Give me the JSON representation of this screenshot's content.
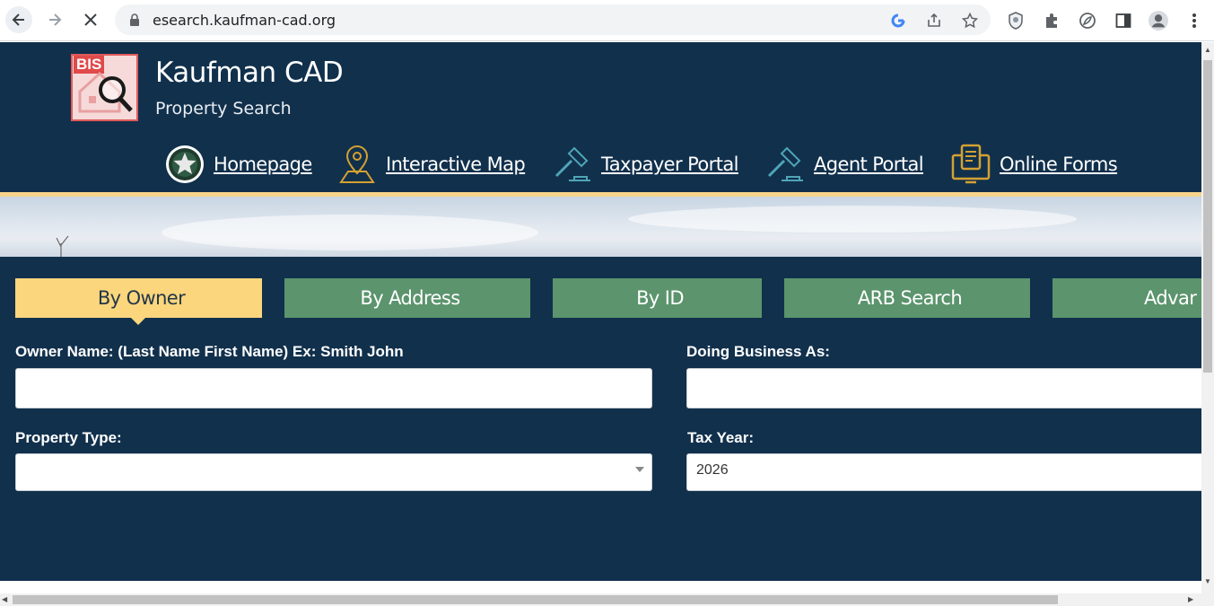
{
  "browser": {
    "url": "esearch.kaufman-cad.org",
    "icons": [
      "back-icon",
      "forward-icon",
      "stop-loading-icon",
      "lock-icon",
      "google-icon",
      "share-icon",
      "star-icon",
      "shield-extension-icon",
      "puzzle-icon",
      "leaf-icon",
      "side-panel-icon",
      "profile-icon",
      "menu-icon"
    ]
  },
  "header": {
    "logo_text": "BIS",
    "title": "Kaufman CAD",
    "subtitle": "Property Search"
  },
  "nav": {
    "items": [
      {
        "label": "Homepage",
        "icon": "star-seal-icon"
      },
      {
        "label": "Interactive Map",
        "icon": "map-pin-icon"
      },
      {
        "label": "Taxpayer Portal",
        "icon": "gavel-icon"
      },
      {
        "label": "Agent Portal",
        "icon": "gavel-icon"
      },
      {
        "label": "Online Forms",
        "icon": "forms-monitor-icon"
      }
    ]
  },
  "tabs": [
    {
      "label": "By Owner",
      "glyph": "",
      "active": true
    },
    {
      "label": "By Address",
      "glyph": ""
    },
    {
      "label": "By ID",
      "glyph": ""
    },
    {
      "label": "ARB Search",
      "glyph": ""
    },
    {
      "label": "Advar",
      "glyph": ""
    }
  ],
  "form": {
    "owner_name_label": "Owner Name: (Last Name First Name) Ex: Smith John",
    "owner_name_value": "",
    "dba_label": "Doing Business As:",
    "dba_value": "",
    "property_type_label": "Property Type:",
    "property_type_value": "",
    "tax_year_label": "Tax Year:",
    "tax_year_value": "2026"
  },
  "colors": {
    "page_bg": "#11304c",
    "active_tab": "#fbd67c",
    "tab_green": "#5b946d",
    "gold_bar": "#f6d48a"
  }
}
